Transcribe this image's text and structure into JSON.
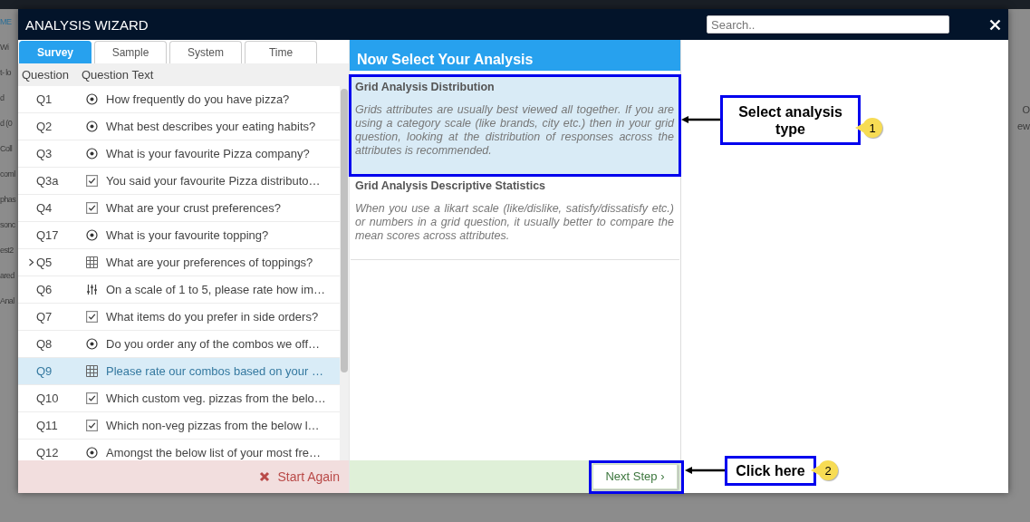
{
  "background": {
    "left_texts": [
      "ME",
      "Wi",
      "t- lo",
      "d",
      "d (0",
      "Coll",
      "coml",
      "phas",
      "sonc",
      "est2",
      "ared",
      "Anal"
    ],
    "right_texts": [
      "O",
      "ew"
    ]
  },
  "window": {
    "title": "ANALYSIS WIZARD",
    "search": {
      "placeholder": "Search.."
    }
  },
  "tabs": [
    {
      "label": "Survey",
      "selected": true
    },
    {
      "label": "Sample",
      "selected": false
    },
    {
      "label": "System",
      "selected": false
    },
    {
      "label": "Time",
      "selected": false
    }
  ],
  "question_table": {
    "columns": [
      "Question",
      "Question Text"
    ],
    "rows": [
      {
        "id": "Q1",
        "kind": "radio",
        "text": "How frequently do you have pizza?",
        "expandable": false,
        "selected": false
      },
      {
        "id": "Q2",
        "kind": "radio",
        "text": "What best describes your eating habits?",
        "expandable": false,
        "selected": false
      },
      {
        "id": "Q3",
        "kind": "radio",
        "text": "What is your favourite Pizza company?",
        "expandable": false,
        "selected": false
      },
      {
        "id": "Q3a",
        "kind": "checkbox",
        "text": "You said your favourite Pizza distributo…",
        "expandable": false,
        "selected": false
      },
      {
        "id": "Q4",
        "kind": "checkbox",
        "text": "What are your crust preferences?",
        "expandable": false,
        "selected": false
      },
      {
        "id": "Q17",
        "kind": "radio",
        "text": "What is your favourite topping?",
        "expandable": false,
        "selected": false
      },
      {
        "id": "Q5",
        "kind": "grid",
        "text": "What are your preferences of toppings?",
        "expandable": true,
        "selected": false
      },
      {
        "id": "Q6",
        "kind": "slider",
        "text": "On a scale of 1 to 5, please rate how im…",
        "expandable": false,
        "selected": false
      },
      {
        "id": "Q7",
        "kind": "checkbox",
        "text": "What items do you prefer in side orders?",
        "expandable": false,
        "selected": false
      },
      {
        "id": "Q8",
        "kind": "radio",
        "text": "Do you order any of the combos we off…",
        "expandable": false,
        "selected": false
      },
      {
        "id": "Q9",
        "kind": "grid",
        "text": "Please rate our combos based on your …",
        "expandable": false,
        "selected": true
      },
      {
        "id": "Q10",
        "kind": "checkbox",
        "text": "Which custom veg. pizzas from the belo…",
        "expandable": false,
        "selected": false
      },
      {
        "id": "Q11",
        "kind": "checkbox",
        "text": "Which non-veg pizzas from the below l…",
        "expandable": false,
        "selected": false
      },
      {
        "id": "Q12",
        "kind": "radio",
        "text": "Amongst the below list of your most fre…",
        "expandable": false,
        "selected": false
      }
    ]
  },
  "start_again": {
    "label": "Start Again"
  },
  "analysis": {
    "title": "Now Select Your Analysis",
    "options": [
      {
        "title": "Grid Analysis Distribution",
        "description": "Grids attributes are usually best viewed all together. If you are using a category scale (like brands, city etc.) then in your grid question, looking at the distribution of responses across the attributes is recommended.",
        "selected": true,
        "annotated": true
      },
      {
        "title": "Grid Analysis Descriptive Statistics",
        "description": "When you use a likart scale (like/dislike, satisfy/dissatisfy etc.) or numbers in a grid question, it usually better to compare the mean scores across attributes.",
        "selected": false,
        "annotated": false
      }
    ]
  },
  "next_step": {
    "label": "Next Step ›",
    "annotated": true
  },
  "callouts": [
    {
      "text": "Select analysis type",
      "number": "1"
    },
    {
      "text": "Click here",
      "number": "2"
    }
  ]
}
